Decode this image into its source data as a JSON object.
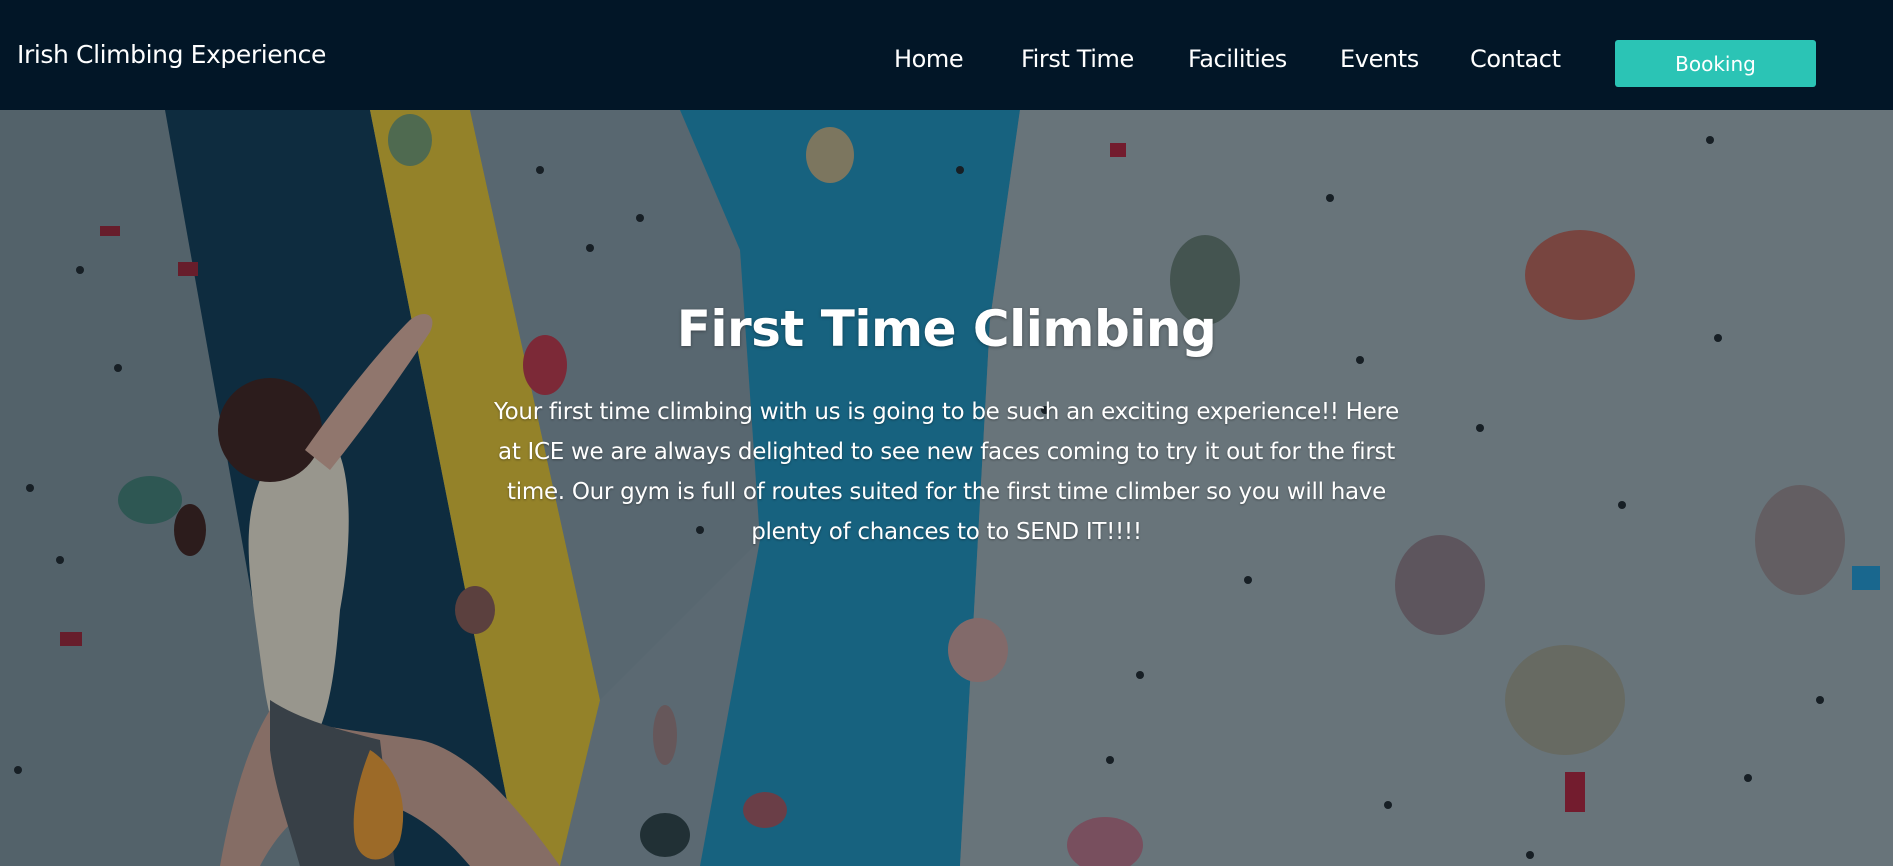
{
  "navbar": {
    "brand": "Irish Climbing Experience",
    "links": [
      {
        "label": "Home"
      },
      {
        "label": "First Time"
      },
      {
        "label": "Facilities"
      },
      {
        "label": "Events"
      },
      {
        "label": "Contact"
      }
    ],
    "booking_label": "Booking"
  },
  "hero": {
    "title": "First Time Climbing",
    "text": "Your first time climbing with us is going to be such an exciting experience!! Here at ICE we are always delighted to see new faces coming to try it out for the first time. Our gym is full of routes suited for the first time climber so you will have plenty of chances to to SEND IT!!!!"
  },
  "colors": {
    "nav_bg": "#021627",
    "accent": "#2bc4b5",
    "wall_blue": "#1e8ab0",
    "wall_yellow": "#d9b82a",
    "wall_grey": "#7c8a92"
  },
  "icons": {
    "hero_background": "climbing-wall-photo"
  }
}
